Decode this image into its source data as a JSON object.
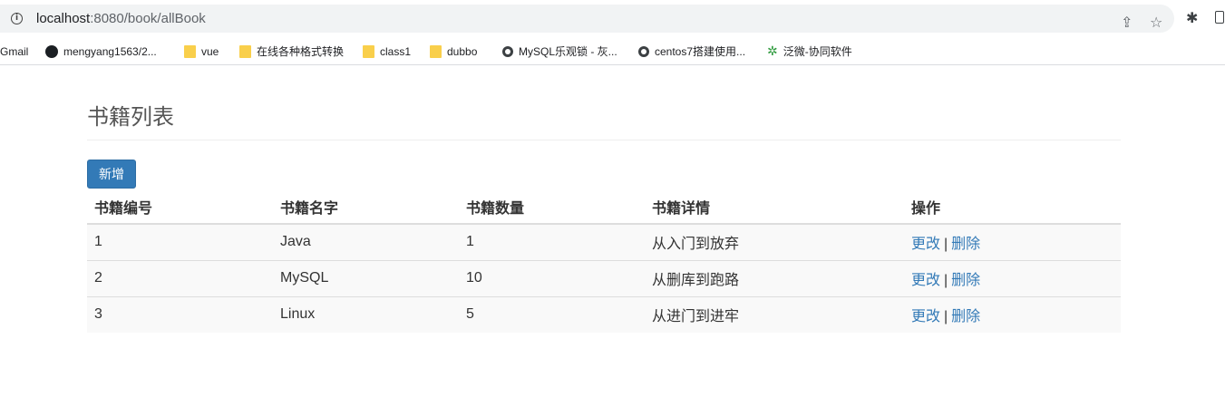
{
  "browser": {
    "url_host": "localhost",
    "url_path": ":8080/book/allBook",
    "info_glyph": "i",
    "share_icon": "share-icon",
    "star_icon": "star-icon",
    "extensions_icon": "puzzle-icon",
    "sidepanel_icon": "side-panel-icon"
  },
  "bookmarks": [
    {
      "label": "Gmail",
      "icon": "none"
    },
    {
      "label": "mengyang1563/2...",
      "icon": "github-icon"
    },
    {
      "label": "vue",
      "icon": "folder-icon"
    },
    {
      "label": "在线各种格式转换",
      "icon": "folder-icon"
    },
    {
      "label": "class1",
      "icon": "folder-icon"
    },
    {
      "label": "dubbo",
      "icon": "folder-icon"
    },
    {
      "label": "MySQL乐观锁 - 灰...",
      "icon": "globe-icon"
    },
    {
      "label": "centos7搭建使用...",
      "icon": "globe-icon"
    },
    {
      "label": "泛微-协同软件",
      "icon": "weaver-icon"
    }
  ],
  "page": {
    "title": "书籍列表",
    "add_button": "新增",
    "accent_color": "#337ab7"
  },
  "table": {
    "headers": [
      "书籍编号",
      "书籍名字",
      "书籍数量",
      "书籍详情",
      "操作"
    ],
    "rows": [
      {
        "id": "1",
        "name": "Java",
        "count": "1",
        "detail": "从入门到放弃"
      },
      {
        "id": "2",
        "name": "MySQL",
        "count": "10",
        "detail": "从删库到跑路"
      },
      {
        "id": "3",
        "name": "Linux",
        "count": "5",
        "detail": "从进门到进牢"
      }
    ],
    "action_edit": "更改",
    "action_separator": "|",
    "action_delete": "删除"
  }
}
